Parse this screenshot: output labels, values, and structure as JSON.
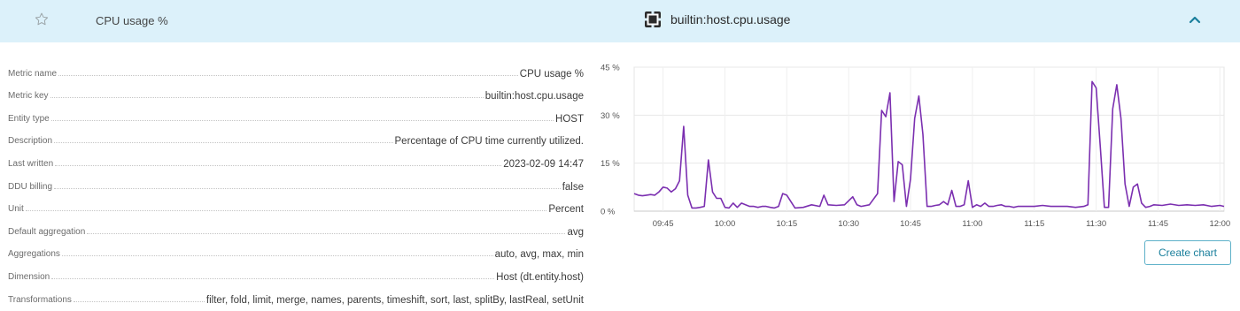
{
  "header": {
    "title": "CPU usage %",
    "metric_key": "builtin:host.cpu.usage",
    "star_icon": "star-icon",
    "metric_icon": "metric-icon",
    "collapse_icon": "chevron-up-icon"
  },
  "properties": [
    {
      "label": "Metric name",
      "value": "CPU usage %"
    },
    {
      "label": "Metric key",
      "value": "builtin:host.cpu.usage"
    },
    {
      "label": "Entity type",
      "value": "HOST"
    },
    {
      "label": "Description",
      "value": "Percentage of CPU time currently utilized."
    },
    {
      "label": "Last written",
      "value": "2023-02-09 14:47"
    },
    {
      "label": "DDU billing",
      "value": "false"
    },
    {
      "label": "Unit",
      "value": "Percent"
    },
    {
      "label": "Default aggregation",
      "value": "avg"
    },
    {
      "label": "Aggregations",
      "value": "auto, avg, max, min"
    },
    {
      "label": "Dimension",
      "value": "Host (dt.entity.host)"
    },
    {
      "label": "Transformations",
      "value": "filter, fold, limit, merge, names, parents, timeshift, sort, last, splitBy, lastReal, setUnit"
    }
  ],
  "actions": {
    "create_chart": "Create chart"
  },
  "colors": {
    "header_bg": "#dcf1fa",
    "line": "#7b2fb0",
    "button_border": "#5eb1c9",
    "button_text": "#1a7f9c"
  },
  "chart_data": {
    "type": "line",
    "x_ticks": [
      "09:45",
      "10:00",
      "10:15",
      "10:30",
      "10:45",
      "11:00",
      "11:15",
      "11:30",
      "11:45",
      "12:00"
    ],
    "y_ticks": [
      "0 %",
      "15 %",
      "30 %",
      "45 %"
    ],
    "ylim": [
      0,
      45
    ],
    "xlim": [
      "09:38",
      "12:01"
    ],
    "grid": true,
    "series": [
      {
        "x": [
          "09:38",
          "09:39",
          "09:40",
          "09:41",
          "09:42",
          "09:43",
          "09:44",
          "09:45",
          "09:46",
          "09:47",
          "09:48",
          "09:49",
          "09:50",
          "09:51",
          "09:52",
          "09:53",
          "09:54",
          "09:55",
          "09:56",
          "09:57",
          "09:58",
          "09:59",
          "10:00",
          "10:01",
          "10:02",
          "10:03",
          "10:04",
          "10:05",
          "10:06",
          "10:07",
          "10:08",
          "10:09",
          "10:10",
          "10:11",
          "10:12",
          "10:13",
          "10:14",
          "10:15",
          "10:17",
          "10:19",
          "10:21",
          "10:23",
          "10:24",
          "10:25",
          "10:27",
          "10:29",
          "10:31",
          "10:32",
          "10:33",
          "10:35",
          "10:37",
          "10:38",
          "10:39",
          "10:40",
          "10:41",
          "10:42",
          "10:43",
          "10:44",
          "10:45",
          "10:46",
          "10:47",
          "10:48",
          "10:49",
          "10:50",
          "10:51",
          "10:52",
          "10:53",
          "10:54",
          "10:55",
          "10:56",
          "10:57",
          "10:58",
          "10:59",
          "11:00",
          "11:01",
          "11:02",
          "11:03",
          "11:04",
          "11:05",
          "11:06",
          "11:07",
          "11:08",
          "11:09",
          "11:10",
          "11:11",
          "11:13",
          "11:15",
          "11:17",
          "11:19",
          "11:21",
          "11:23",
          "11:25",
          "11:27",
          "11:28",
          "11:29",
          "11:30",
          "11:31",
          "11:32",
          "11:33",
          "11:34",
          "11:35",
          "11:36",
          "11:37",
          "11:38",
          "11:39",
          "11:40",
          "11:41",
          "11:42",
          "11:43",
          "11:44",
          "11:46",
          "11:48",
          "11:50",
          "11:52",
          "11:54",
          "11:56",
          "11:58",
          "12:00",
          "12:01"
        ],
        "y": [
          5.5,
          5.0,
          4.8,
          5.0,
          5.2,
          5.0,
          6.0,
          7.5,
          7.2,
          6.0,
          7.0,
          9.5,
          26.5,
          5.0,
          1.0,
          1.0,
          1.2,
          1.5,
          16.0,
          6.0,
          4.0,
          4.0,
          1.2,
          1.0,
          2.5,
          1.2,
          2.5,
          2.0,
          1.5,
          1.5,
          1.2,
          1.5,
          1.5,
          1.2,
          1.0,
          1.5,
          5.5,
          5.0,
          1.0,
          1.2,
          2.0,
          1.5,
          5.0,
          2.0,
          1.8,
          2.0,
          4.5,
          2.0,
          1.5,
          2.0,
          5.5,
          31.5,
          29.5,
          37.0,
          3.0,
          15.5,
          14.5,
          1.5,
          10.0,
          29.0,
          36.0,
          24.0,
          1.5,
          1.5,
          1.8,
          2.0,
          3.0,
          2.0,
          6.5,
          1.5,
          1.5,
          2.0,
          9.5,
          1.2,
          2.0,
          1.5,
          2.5,
          1.5,
          1.5,
          1.8,
          2.0,
          1.5,
          1.5,
          1.2,
          1.5,
          1.5,
          1.5,
          1.8,
          1.5,
          1.5,
          1.5,
          1.2,
          1.5,
          2.0,
          40.5,
          38.5,
          20.0,
          1.2,
          1.2,
          32.0,
          39.5,
          29.0,
          8.5,
          1.5,
          7.5,
          8.5,
          2.5,
          1.2,
          1.5,
          2.0,
          1.8,
          2.2,
          1.8,
          2.0,
          1.8,
          2.0,
          1.5,
          1.8,
          1.5
        ]
      }
    ]
  }
}
